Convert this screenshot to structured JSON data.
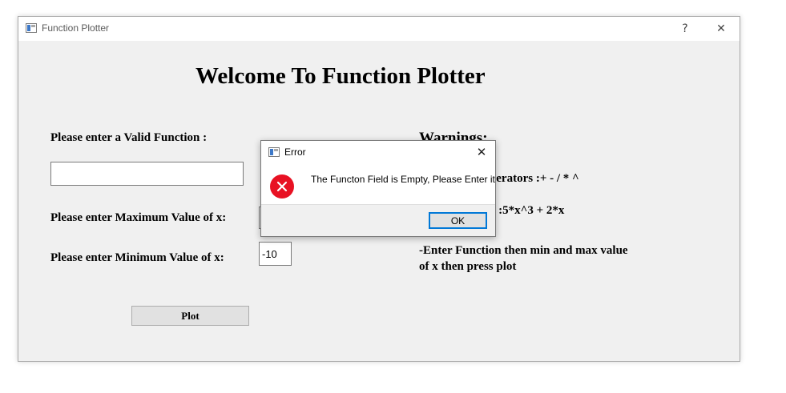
{
  "window": {
    "title": "Function Plotter",
    "help_glyph": "?",
    "close_glyph": "✕"
  },
  "main": {
    "heading": "Welcome To Function Plotter",
    "function_label": "Please enter a Valid Function :",
    "function_value": "",
    "max_label": "Please enter Maximum Value of x:",
    "max_value": "",
    "min_label": "Please enter Minimum Value of x:",
    "min_value": "-10",
    "plot_button": "Plot",
    "warnings_title": "Warnings:",
    "warning_operators": "-Supported Operators :+ - / * ^",
    "warning_functions": "-Functions like :5*x^3 + 2*x",
    "warning_usage_line1": "-Enter Function then min and max value",
    "warning_usage_line2": "of x then press plot"
  },
  "dialog": {
    "title": "Error",
    "message": "The Functon Field is Empty, Please Enter it",
    "ok_label": "OK",
    "close_glyph": "✕"
  },
  "colors": {
    "window_bg": "#f0f0f0",
    "error_icon": "#e81123",
    "focus_border": "#0078d7"
  },
  "icons": [
    "app-window-icon",
    "help-icon",
    "close-icon",
    "error-icon"
  ]
}
